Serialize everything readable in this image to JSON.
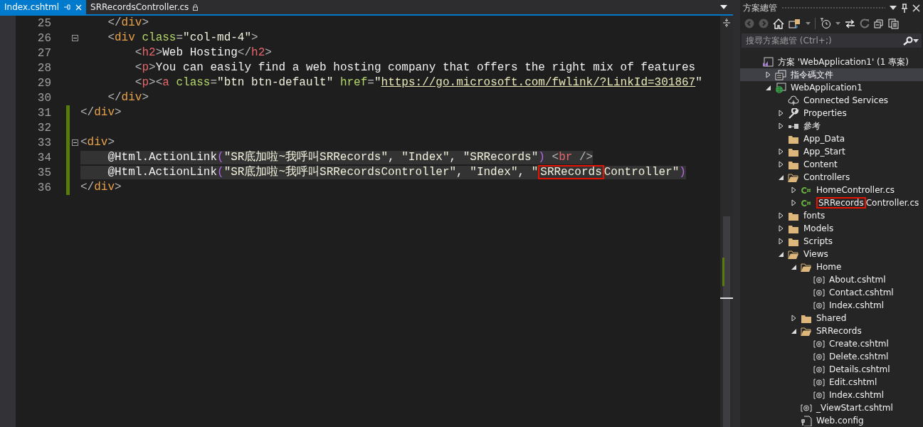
{
  "tabs": [
    {
      "label": "Index.cshtml",
      "selected": true,
      "locked": false
    },
    {
      "label": "SRRecordsController.cs",
      "selected": false,
      "locked": true
    }
  ],
  "code_lines": [
    {
      "number": "25",
      "fold": false,
      "changed": false,
      "highlighted": false,
      "tokens": [
        {
          "kind": "punct",
          "text": "    </"
        },
        {
          "kind": "tag",
          "text": "div"
        },
        {
          "kind": "punct",
          "text": ">"
        }
      ]
    },
    {
      "number": "26",
      "fold": true,
      "changed": false,
      "highlighted": false,
      "tokens": [
        {
          "kind": "punct",
          "text": "    <"
        },
        {
          "kind": "tag",
          "text": "div"
        },
        {
          "kind": "attr",
          "text": " class"
        },
        {
          "kind": "punct",
          "text": "="
        },
        {
          "kind": "string",
          "text": "\"col-md-4\""
        },
        {
          "kind": "punct",
          "text": ">"
        }
      ]
    },
    {
      "number": "27",
      "fold": false,
      "changed": false,
      "highlighted": false,
      "tokens": [
        {
          "kind": "punct",
          "text": "        <"
        },
        {
          "kind": "element",
          "text": "h2"
        },
        {
          "kind": "punct",
          "text": ">"
        },
        {
          "kind": "text",
          "text": "Web Hosting"
        },
        {
          "kind": "punct",
          "text": "</"
        },
        {
          "kind": "element",
          "text": "h2"
        },
        {
          "kind": "punct",
          "text": ">"
        }
      ]
    },
    {
      "number": "28",
      "fold": false,
      "changed": false,
      "highlighted": false,
      "tokens": [
        {
          "kind": "punct",
          "text": "        <"
        },
        {
          "kind": "element",
          "text": "p"
        },
        {
          "kind": "punct",
          "text": ">"
        },
        {
          "kind": "text",
          "text": "You can easily find a web hosting company that offers the right mix of features"
        }
      ]
    },
    {
      "number": "29",
      "fold": false,
      "changed": false,
      "highlighted": false,
      "tokens": [
        {
          "kind": "punct",
          "text": "        <"
        },
        {
          "kind": "element",
          "text": "p"
        },
        {
          "kind": "punct",
          "text": "><"
        },
        {
          "kind": "element",
          "text": "a"
        },
        {
          "kind": "attr",
          "text": " class"
        },
        {
          "kind": "punct",
          "text": "="
        },
        {
          "kind": "string",
          "text": "\"btn btn-default\""
        },
        {
          "kind": "attr",
          "text": " href"
        },
        {
          "kind": "punct",
          "text": "="
        },
        {
          "kind": "string",
          "text": "\""
        },
        {
          "kind": "url",
          "text": "https://go.microsoft.com/fwlink/?LinkId=301867"
        },
        {
          "kind": "string",
          "text": "\""
        }
      ]
    },
    {
      "number": "30",
      "fold": false,
      "changed": false,
      "highlighted": false,
      "tokens": [
        {
          "kind": "punct",
          "text": "    </"
        },
        {
          "kind": "tag",
          "text": "div"
        },
        {
          "kind": "punct",
          "text": ">"
        }
      ]
    },
    {
      "number": "31",
      "fold": false,
      "changed": true,
      "highlighted": false,
      "tokens": [
        {
          "kind": "punct",
          "text": "</"
        },
        {
          "kind": "tag",
          "text": "div"
        },
        {
          "kind": "punct",
          "text": ">"
        }
      ]
    },
    {
      "number": "32",
      "fold": false,
      "changed": true,
      "highlighted": false
    },
    {
      "number": "33",
      "fold": true,
      "changed": true,
      "highlighted": false,
      "tokens": [
        {
          "kind": "punct",
          "text": "<"
        },
        {
          "kind": "tag",
          "text": "div"
        },
        {
          "kind": "punct",
          "text": ">"
        }
      ]
    },
    {
      "number": "34",
      "fold": false,
      "changed": true,
      "highlighted": true,
      "tokens": [
        {
          "kind": "razor",
          "text": "    @Html.ActionLink"
        },
        {
          "kind": "paren",
          "text": "("
        },
        {
          "kind": "string",
          "text": "\"SR底加啦~我呼叫SRRecords\""
        },
        {
          "kind": "text",
          "text": ", "
        },
        {
          "kind": "string",
          "text": "\"Index\""
        },
        {
          "kind": "text",
          "text": ", "
        },
        {
          "kind": "string",
          "text": "\"SRRecords\""
        },
        {
          "kind": "paren",
          "text": ")"
        },
        {
          "kind": "punct",
          "text": " <"
        },
        {
          "kind": "element",
          "text": "br"
        },
        {
          "kind": "punct",
          "text": " />"
        }
      ]
    },
    {
      "number": "35",
      "fold": false,
      "changed": true,
      "highlighted": true,
      "tokens": [
        {
          "kind": "razor",
          "text": "    @Html.ActionLink"
        },
        {
          "kind": "paren",
          "text": "("
        },
        {
          "kind": "string",
          "text": "\"SR底加啦~我呼叫SRRecordsController\""
        },
        {
          "kind": "text",
          "text": ", "
        },
        {
          "kind": "string",
          "text": "\"Index\""
        },
        {
          "kind": "text",
          "text": ", "
        },
        {
          "kind": "string",
          "text": "\""
        },
        {
          "kind": "string",
          "text": "SRRecords",
          "boxed": true
        },
        {
          "kind": "string",
          "text": "Controller\""
        },
        {
          "kind": "paren",
          "text": ")"
        }
      ]
    },
    {
      "number": "36",
      "fold": false,
      "changed": true,
      "highlighted": false,
      "tokens": [
        {
          "kind": "punct",
          "text": "</"
        },
        {
          "kind": "tag",
          "text": "div"
        },
        {
          "kind": "punct",
          "text": ">"
        }
      ]
    }
  ],
  "explorer": {
    "title": "方案總管",
    "search": {
      "placeholder": "搜尋方案總管 (Ctrl+;)"
    },
    "tree": [
      {
        "label": "方案 'WebApplication1' (1 專案)",
        "kind": "solution",
        "hovered": false,
        "children": [
          {
            "label": "指令碼文件",
            "kind": "scripts",
            "expanded": false,
            "hovered": true
          },
          {
            "label": "WebApplication1",
            "kind": "web",
            "expanded": true,
            "hovered": false,
            "children": [
              {
                "label": "Connected Services",
                "kind": "cloud",
                "hovered": false
              },
              {
                "label": "Properties",
                "kind": "wrench",
                "expanded": false,
                "hovered": false
              },
              {
                "label": "參考",
                "kind": "references",
                "expanded": false,
                "hovered": false
              },
              {
                "label": "App_Data",
                "kind": "folder",
                "hovered": false
              },
              {
                "label": "App_Start",
                "kind": "folder",
                "expanded": false,
                "hovered": false
              },
              {
                "label": "Content",
                "kind": "folder",
                "expanded": false,
                "hovered": false
              },
              {
                "label": "Controllers",
                "kind": "folder",
                "expanded": true,
                "hovered": false,
                "children": [
                  {
                    "label": "HomeController.cs",
                    "kind": "csharp",
                    "expanded": false,
                    "hovered": false
                  },
                  {
                    "label_parts": [
                      {
                        "text": "SRRecords",
                        "boxed": true
                      },
                      {
                        "text": "Controller.cs",
                        "boxed": false
                      }
                    ],
                    "kind": "csharp",
                    "expanded": false,
                    "hovered": false
                  }
                ]
              },
              {
                "label": "fonts",
                "kind": "folder",
                "expanded": false,
                "hovered": false
              },
              {
                "label": "Models",
                "kind": "folder",
                "expanded": false,
                "hovered": false
              },
              {
                "label": "Scripts",
                "kind": "folder",
                "expanded": false,
                "hovered": false
              },
              {
                "label": "Views",
                "kind": "folder",
                "expanded": true,
                "hovered": false,
                "children": [
                  {
                    "label": "Home",
                    "kind": "folder",
                    "expanded": true,
                    "hovered": false,
                    "children": [
                      {
                        "label": "About.cshtml",
                        "kind": "razor",
                        "hovered": false
                      },
                      {
                        "label": "Contact.cshtml",
                        "kind": "razor",
                        "hovered": false
                      },
                      {
                        "label": "Index.cshtml",
                        "kind": "razor",
                        "hovered": false
                      }
                    ]
                  },
                  {
                    "label": "Shared",
                    "kind": "folder",
                    "expanded": false,
                    "hovered": false
                  },
                  {
                    "label": "SRRecords",
                    "kind": "folder",
                    "expanded": true,
                    "hovered": false,
                    "children": [
                      {
                        "label": "Create.cshtml",
                        "kind": "razor",
                        "hovered": false
                      },
                      {
                        "label": "Delete.cshtml",
                        "kind": "razor",
                        "hovered": false
                      },
                      {
                        "label": "Details.cshtml",
                        "kind": "razor",
                        "hovered": false
                      },
                      {
                        "label": "Edit.cshtml",
                        "kind": "razor",
                        "hovered": false
                      },
                      {
                        "label": "Index.cshtml",
                        "kind": "razor",
                        "hovered": false
                      }
                    ]
                  },
                  {
                    "label": "_ViewStart.cshtml",
                    "kind": "razor",
                    "hovered": false
                  },
                  {
                    "label": "Web.config",
                    "kind": "config",
                    "hovered": false
                  }
                ]
              }
            ]
          }
        ]
      }
    ]
  }
}
